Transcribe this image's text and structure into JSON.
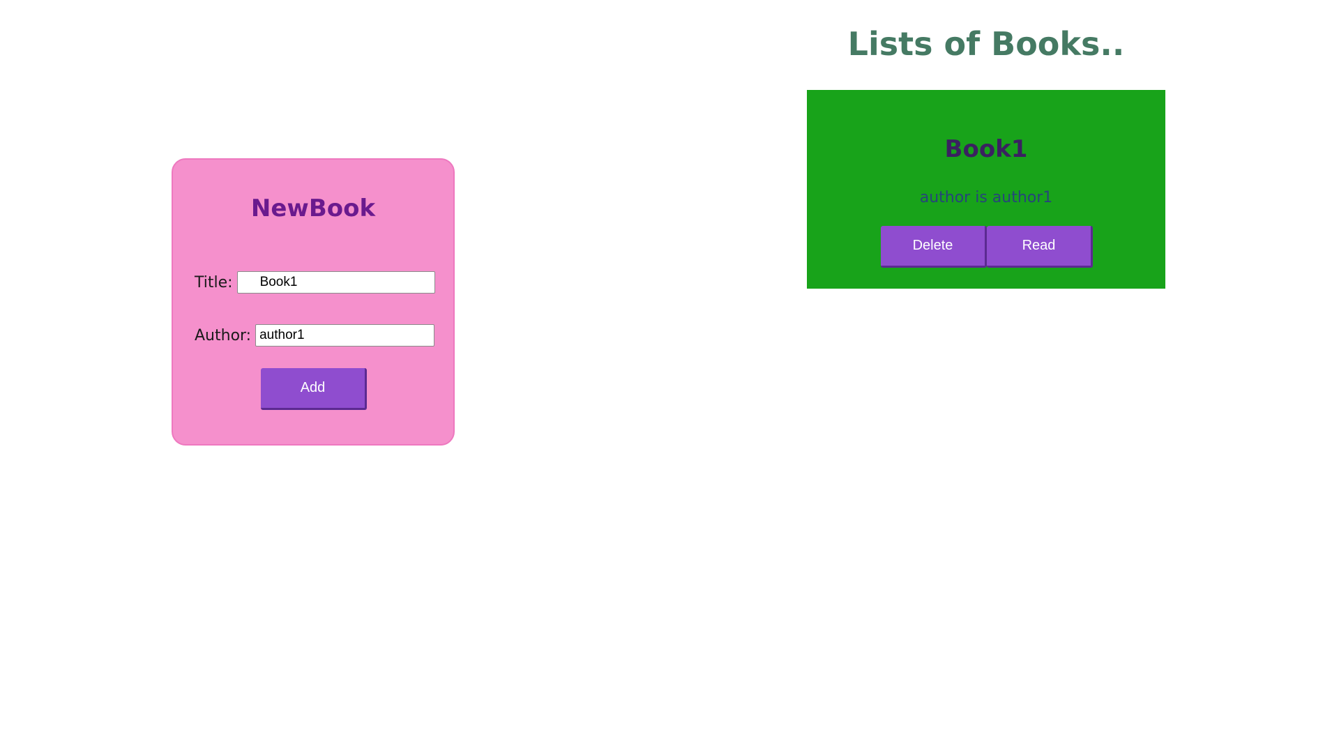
{
  "new_book_form": {
    "title": "NewBook",
    "title_label": "Title:",
    "title_value": "Book1",
    "author_label": "Author:",
    "author_value": "author1",
    "add_label": "Add"
  },
  "book_list": {
    "heading": "Lists of Books..",
    "books": [
      {
        "title": "Book1",
        "author_text": "author is author1",
        "delete_label": "Delete",
        "read_label": "Read"
      }
    ]
  },
  "colors": {
    "form_background": "#f590cc",
    "form_title": "#6a1a8e",
    "button": "#8f4dcf",
    "list_heading": "#457a63",
    "book_card": "#18a31a",
    "book_title": "#3a2160",
    "book_author": "#26457a"
  }
}
